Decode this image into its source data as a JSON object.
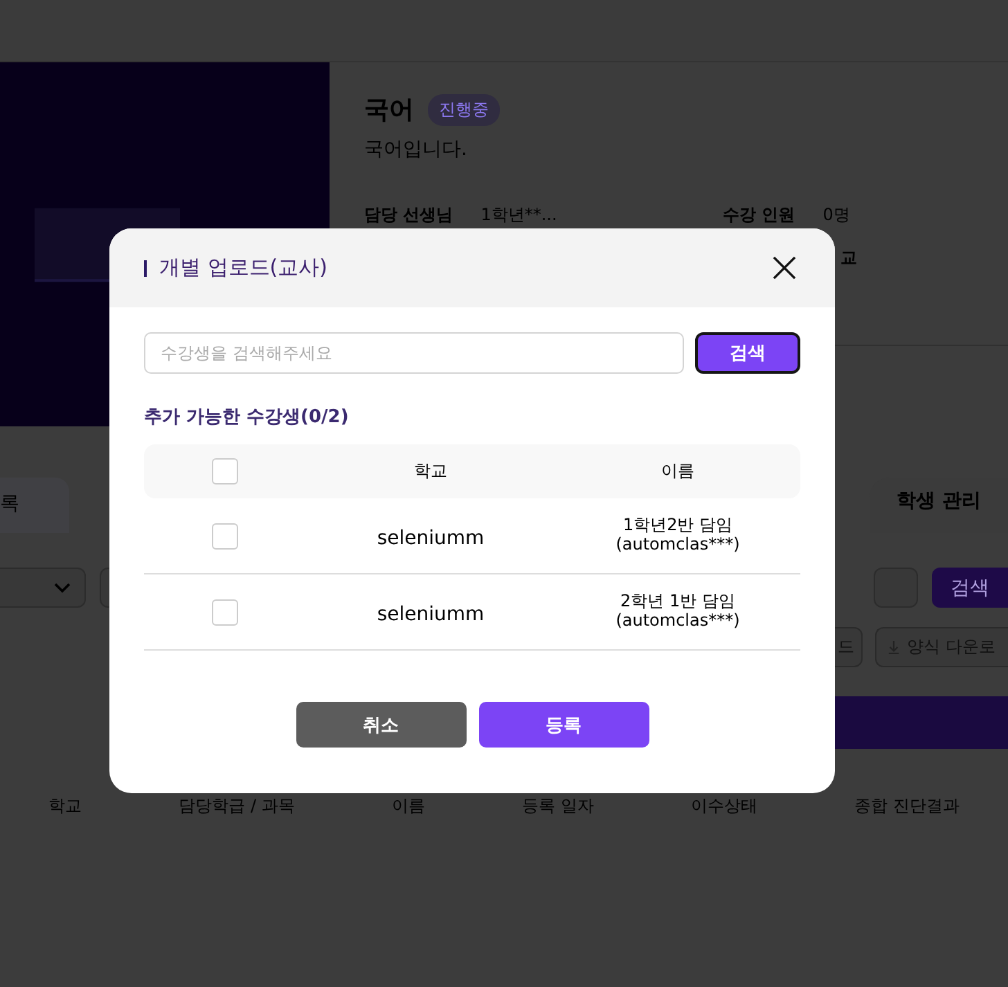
{
  "course": {
    "title": "국어",
    "status": "진행중",
    "description": "국어입니다.",
    "info": [
      {
        "label": "담당 선생님",
        "value": "1학년**..."
      },
      {
        "label": "수강 인원",
        "value": "0명"
      }
    ],
    "info_fragment": "교"
  },
  "tabs": [
    {
      "label": "록",
      "selected": false
    },
    {
      "label": "학생 관리",
      "selected": true
    }
  ],
  "filters": {
    "search_button": "검색"
  },
  "actions": [
    {
      "label": "드",
      "kind": "plain"
    },
    {
      "label": "양식 다운로",
      "kind": "download"
    }
  ],
  "table": {
    "columns": [
      "학교",
      "담당학급 / 과목",
      "이름",
      "등록 일자",
      "이수상태",
      "종합 진단결과"
    ]
  },
  "dialog": {
    "title": "개별 업로드(교사)",
    "search": {
      "placeholder": "수강생을 검색해주세요"
    },
    "search_button": "검색",
    "subtitle": "추가 가능한 수강생(0/2)",
    "columns": [
      "학교",
      "이름"
    ],
    "all_checked": false,
    "rows": [
      {
        "checked": false,
        "school": "seleniumm",
        "name": "1학년2반 담임\n(automclas***)"
      },
      {
        "checked": false,
        "school": "seleniumm",
        "name": "2학년 1반 담임\n(automclas***)"
      }
    ],
    "buttons": [
      {
        "kind": "cancel",
        "label": "취소"
      },
      {
        "kind": "submit",
        "label": "등록"
      }
    ]
  }
}
